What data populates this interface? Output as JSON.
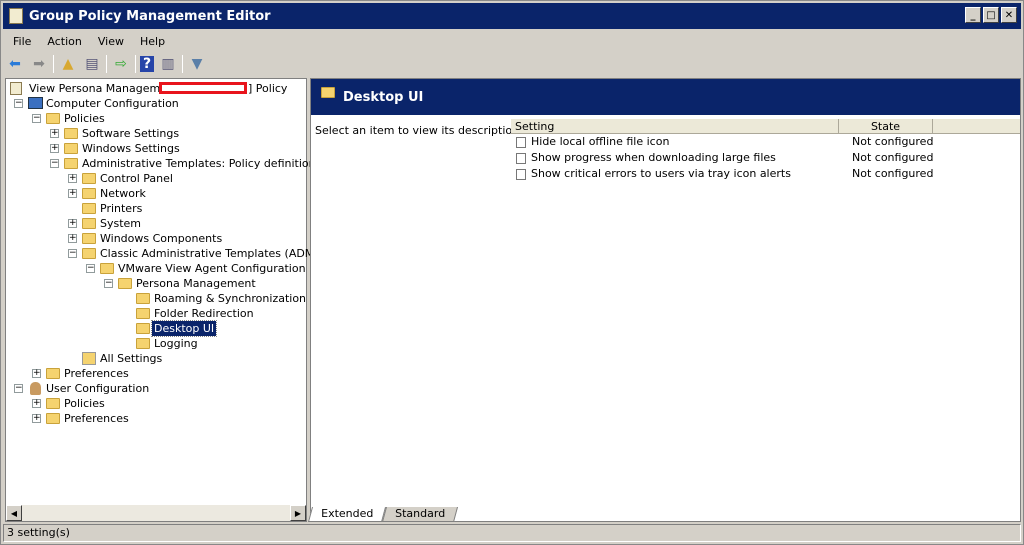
{
  "window": {
    "title": "Group Policy Management Editor",
    "controls": [
      "_",
      "□",
      "✕"
    ]
  },
  "menu": [
    "File",
    "Action",
    "View",
    "Help"
  ],
  "toolbar": [
    "back-icon",
    "forward-icon",
    "up-folder-icon",
    "show-hide-tree-icon",
    "export-icon",
    "help-icon",
    "show-hide-action-icon",
    "filter-icon"
  ],
  "tree": [
    {
      "label": "View Persona Management [",
      "suffix": "] Policy",
      "level": -1,
      "exp": "",
      "icon": "gpo"
    },
    {
      "label": "Computer Configuration",
      "level": 0,
      "exp": "-",
      "icon": "computer"
    },
    {
      "label": "Policies",
      "level": 1,
      "exp": "-",
      "icon": "folder"
    },
    {
      "label": "Software Settings",
      "level": 2,
      "exp": "+",
      "icon": "folder"
    },
    {
      "label": "Windows Settings",
      "level": 2,
      "exp": "+",
      "icon": "folder"
    },
    {
      "label": "Administrative Templates: Policy definitions (ADMX",
      "level": 2,
      "exp": "-",
      "icon": "folder"
    },
    {
      "label": "Control Panel",
      "level": 3,
      "exp": "+",
      "icon": "folder"
    },
    {
      "label": "Network",
      "level": 3,
      "exp": "+",
      "icon": "folder"
    },
    {
      "label": "Printers",
      "level": 3,
      "exp": "",
      "icon": "folder"
    },
    {
      "label": "System",
      "level": 3,
      "exp": "+",
      "icon": "folder"
    },
    {
      "label": "Windows Components",
      "level": 3,
      "exp": "+",
      "icon": "folder"
    },
    {
      "label": "Classic Administrative Templates (ADM)",
      "level": 3,
      "exp": "-",
      "icon": "folder"
    },
    {
      "label": "VMware View Agent Configuration",
      "level": 4,
      "exp": "-",
      "icon": "folder"
    },
    {
      "label": "Persona Management",
      "level": 5,
      "exp": "-",
      "icon": "folder"
    },
    {
      "label": "Roaming & Synchronization",
      "level": 6,
      "exp": "",
      "icon": "folder"
    },
    {
      "label": "Folder Redirection",
      "level": 6,
      "exp": "",
      "icon": "folder"
    },
    {
      "label": "Desktop UI",
      "level": 6,
      "exp": "",
      "icon": "folder",
      "selected": true
    },
    {
      "label": "Logging",
      "level": 6,
      "exp": "",
      "icon": "folder"
    },
    {
      "label": "All Settings",
      "level": 3,
      "exp": "",
      "icon": "settings"
    },
    {
      "label": "Preferences",
      "level": 1,
      "exp": "+",
      "icon": "folder"
    },
    {
      "label": "User Configuration",
      "level": 0,
      "exp": "-",
      "icon": "user"
    },
    {
      "label": "Policies",
      "level": 1,
      "exp": "+",
      "icon": "folder"
    },
    {
      "label": "Preferences",
      "level": 1,
      "exp": "+",
      "icon": "folder"
    }
  ],
  "details": {
    "title": "Desktop UI",
    "description": "Select an item to view its description.",
    "columns": [
      "Setting",
      "State"
    ],
    "rows": [
      {
        "setting": "Hide local offline file icon",
        "state": "Not configured"
      },
      {
        "setting": "Show progress when downloading large files",
        "state": "Not configured"
      },
      {
        "setting": "Show critical errors to users via tray icon alerts",
        "state": "Not configured"
      }
    ]
  },
  "tabs": [
    "Extended",
    "Standard"
  ],
  "status": "3 setting(s)",
  "colors": {
    "titlebar": "#0a246a",
    "redaction": "#e8141c"
  }
}
